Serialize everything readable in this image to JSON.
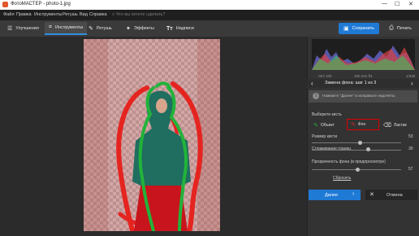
{
  "window": {
    "title": "ФотоМАСТЕР - photo-1.jpg",
    "minimize": "—",
    "maximize": "☐",
    "close": "✕"
  },
  "menu": {
    "items": [
      "Файл",
      "Правка",
      "Инструменты",
      "Ретушь",
      "Вид",
      "Справка"
    ],
    "search_placeholder": "Что вы хотите сделать?"
  },
  "toolbar": {
    "tabs": [
      {
        "label": "Улучшения",
        "icon": "sliders-icon"
      },
      {
        "label": "Инструменты",
        "icon": "crop-tools-icon",
        "active": true
      },
      {
        "label": "Ретушь",
        "icon": "brush-icon"
      },
      {
        "label": "Эффекты",
        "icon": "magic-wand-icon"
      },
      {
        "label": "Надписи",
        "icon": "text-icon"
      }
    ],
    "save_label": "Сохранить",
    "print_label": "Печать"
  },
  "histogram": {
    "iso": "ISO 100",
    "lens": "100 mm f/4",
    "shutter": "1/320"
  },
  "panel": {
    "back": "‹",
    "step_title": "Замена фона: шаг 1 из 3",
    "next_arrow": "›",
    "hint": "Нажмите \"Далее\" и исправьте недочёты",
    "choose_brush": "Выберите кисть",
    "brushes": {
      "object": "Объект",
      "background": "Фон",
      "eraser": "Ластик"
    },
    "selected_brush": "Фон",
    "sliders": [
      {
        "label": "Размер кисти",
        "value": "53",
        "fraction": 0.53
      },
      {
        "label": "Сглаживание границ",
        "value": "30",
        "fraction": 0.3
      },
      {
        "label": "Прозрачность фона (в предпросмотре)",
        "value": "57",
        "fraction": 0.57
      }
    ],
    "reset": "Сбросить",
    "next": "Далее",
    "cancel": "Отмена"
  },
  "colors": {
    "accent": "#1f7ad6",
    "object_stroke": "#22b33a",
    "background_stroke": "#e52420",
    "highlight": "#e00000"
  }
}
